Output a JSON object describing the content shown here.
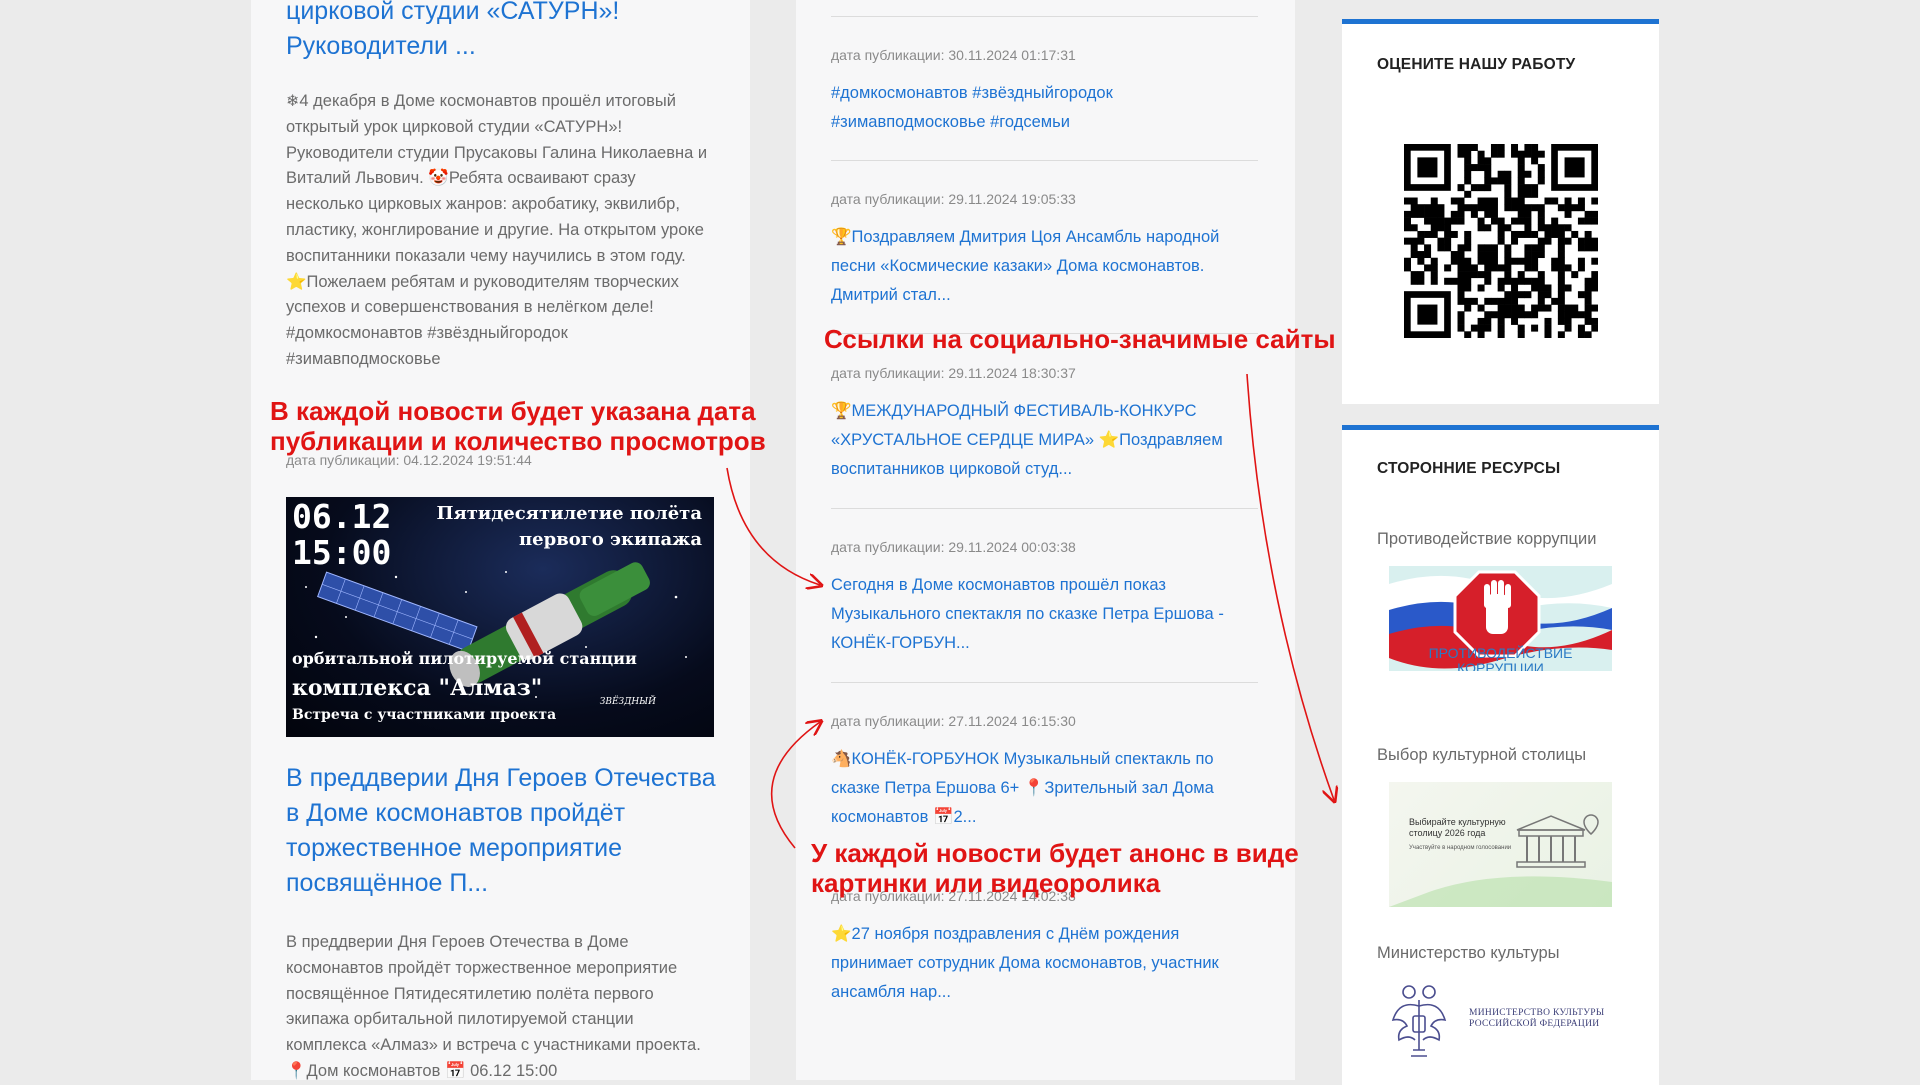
{
  "left": {
    "item1": {
      "title": "циркой студии «САТУРН»! Руководители ...",
      "title_line1": "цирковой студии «САТУРН»!",
      "title_line2": "Руководители ...",
      "text": "4 декабря в Доме космонавтов прошёл итоговый открытый урок цирковой студии «САТУРН»! Руководители студии Прусаковы Галина Николаевна и Виталий Львович. 🤡Ребята осваивают сразу несколько цирковых жанров: акробатику, эквилибр, пластику, жонглирование и другие. На открытом уроке воспитанники показали чему научились в этом году. ⭐Пожелаем ребятам и руководителям творческих успехов и совершенствования в нелёгком деле! #домкосмонавтов #звёздныйгородок #зимавподмосковье",
      "emoji_lead": "❄",
      "date": "дата публикации: 04.12.2024 19:51:44"
    },
    "banner": {
      "date_line1": "06.12",
      "date_line2": "15:00",
      "head_line1": "Пятидесятилетие полёта",
      "head_line2": "первого экипажа",
      "sub": "орбитальной пилотируемой станции",
      "main": "комплекса \"Алмаз\"",
      "meet": "Встреча с участниками проекта",
      "logo": "ЗВЁЗДНЫЙ"
    },
    "item2": {
      "title": "В преддверии Дня Героев Отечества в Доме космонавтов пройдёт торжественное мероприятие посвящённое П...",
      "text": "В преддверии Дня Героев Отечества в Доме космонавтов пройдёт торжественное мероприятие посвящённое Пятидесятилетию полёта первого экипажа орбитальной пилотируемой станции комплекса «Алмаз» и встреча с участниками проекта. 📍Дом космонавтов 📅 06.12 15:00"
    }
  },
  "middle": {
    "items": [
      {
        "date": "дата публикации: 30.11.2024 01:17:31",
        "link": "#домкосмонавтов #звёздныйгородок #зимавподмосковье #годсемьи"
      },
      {
        "date": "дата публикации: 29.11.2024 19:05:33",
        "link": "🏆Поздравляем Дмитрия Цоя Ансамбль народной песни «Космические казаки» Дома космонавтов. Дмитрий стал..."
      },
      {
        "date": "дата публикации: 29.11.2024 18:30:37",
        "link": "🏆МЕЖДУНАРОДНЫЙ ФЕСТИВАЛЬ-КОНКУРС «ХРУСТАЛЬНОЕ СЕРДЦЕ МИРА» ⭐Поздравляем воспитанников цирковой студ..."
      },
      {
        "date": "дата публикации: 29.11.2024 00:03:38",
        "link": "Сегодня в Доме космонавтов прошёл показ Музыкального спектакля по сказке Петра Ершова - КОНЁК-ГОРБУН..."
      },
      {
        "date": "дата публикации: 27.11.2024 16:15:30",
        "link": "🐴КОНЁК-ГОРБУНОК Музыкальный спектакль по сказке Петра Ершова 6+ 📍Зрительный зал Дома космонавтов 📅2..."
      },
      {
        "date": "дата публикации: 27.11.2024 14:02:38",
        "link": "⭐27 ноября поздравления с Днём рождения принимает сотрудник Дома космонавтов, участник ансамбля нар..."
      }
    ]
  },
  "sidebar": {
    "rate": {
      "title": "ОЦЕНИТЕ НАШУ РАБОТУ"
    },
    "resources": {
      "title": "СТОРОННИЕ РЕСУРСЫ",
      "items": [
        {
          "label": "Противодействие коррупции",
          "img_text": "ПРОТИВОДЕЙСТВИЕ КОРРУПЦИИ"
        },
        {
          "label": "Выбор культурной столицы",
          "img_line1": "Выбирайте культурную",
          "img_line2": "столицу 2026 года",
          "img_line3": "Участвуйте в народном голосовании"
        },
        {
          "label": "Министерство культуры",
          "img_line1": "МИНИСТЕРСТВО КУЛЬТУРЫ",
          "img_line2": "РОССИЙСКОЙ ФЕДЕРАЦИИ"
        }
      ]
    }
  },
  "annotations": {
    "date_note": "В каждой новости будет указана дата публикации и количество просмотров",
    "date_note_line1": "В каждой новости будет указана дата",
    "date_note_line2": "публикации и количество просмотров",
    "links_note": "Ссылки на социально-значимые сайты",
    "media_note": "У каждой новости будет анонс в виде картинки или видеоролика",
    "media_note_line1": "У каждой новости будет анонс в виде",
    "media_note_line2": "картинки или видеоролика"
  },
  "colors": {
    "link": "#1e73d2",
    "accent": "#1e73d2",
    "annotation": "#e01414",
    "text_muted": "#6b6b6b"
  }
}
